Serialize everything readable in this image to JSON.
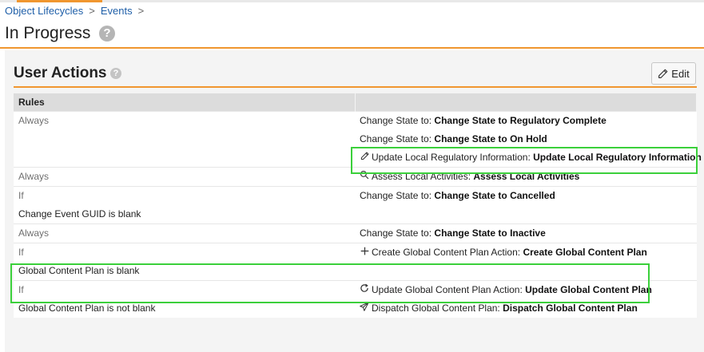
{
  "breadcrumb": {
    "items": [
      "Object Lifecycles",
      "Events"
    ],
    "separator": ">"
  },
  "page": {
    "title": "In Progress"
  },
  "section": {
    "title": "User Actions",
    "edit_label": "Edit"
  },
  "table": {
    "headers": [
      "Rules",
      ""
    ],
    "rows": [
      {
        "condition": [
          "Always"
        ],
        "actions": [
          {
            "icon": "",
            "prefix": "Change State to: ",
            "name": "Change State to Regulatory Complete"
          },
          {
            "icon": "",
            "prefix": "Change State to: ",
            "name": "Change State to On Hold"
          },
          {
            "icon": "pencil-icon",
            "prefix": "Update Local Regulatory Information: ",
            "name": "Update Local Regulatory Information"
          }
        ]
      },
      {
        "condition": [
          "Always"
        ],
        "actions": [
          {
            "icon": "magnify-icon",
            "prefix": "Assess Local Activities: ",
            "name": "Assess Local Activities"
          }
        ]
      },
      {
        "condition": [
          "If",
          "Change Event GUID is blank"
        ],
        "actions": [
          {
            "icon": "",
            "prefix": "Change State to: ",
            "name": "Change State to Cancelled"
          }
        ]
      },
      {
        "condition": [
          "Always"
        ],
        "actions": [
          {
            "icon": "",
            "prefix": "Change State to: ",
            "name": "Change State to Inactive"
          }
        ]
      },
      {
        "condition": [
          "If",
          "Global Content Plan is blank"
        ],
        "actions": [
          {
            "icon": "plus-icon",
            "prefix": "Create Global Content Plan Action: ",
            "name": "Create Global Content Plan"
          }
        ]
      },
      {
        "condition": [
          "If",
          "Global Content Plan is not blank"
        ],
        "actions": [
          {
            "icon": "refresh-icon",
            "prefix": "Update Global Content Plan Action: ",
            "name": "Update Global Content Plan"
          },
          {
            "icon": "send-icon",
            "prefix": "Dispatch Global Content Plan: ",
            "name": "Dispatch Global Content Plan"
          }
        ]
      }
    ]
  },
  "colors": {
    "accent": "#f0962f",
    "highlight": "#3bd03b",
    "link": "#1f5fa8"
  }
}
